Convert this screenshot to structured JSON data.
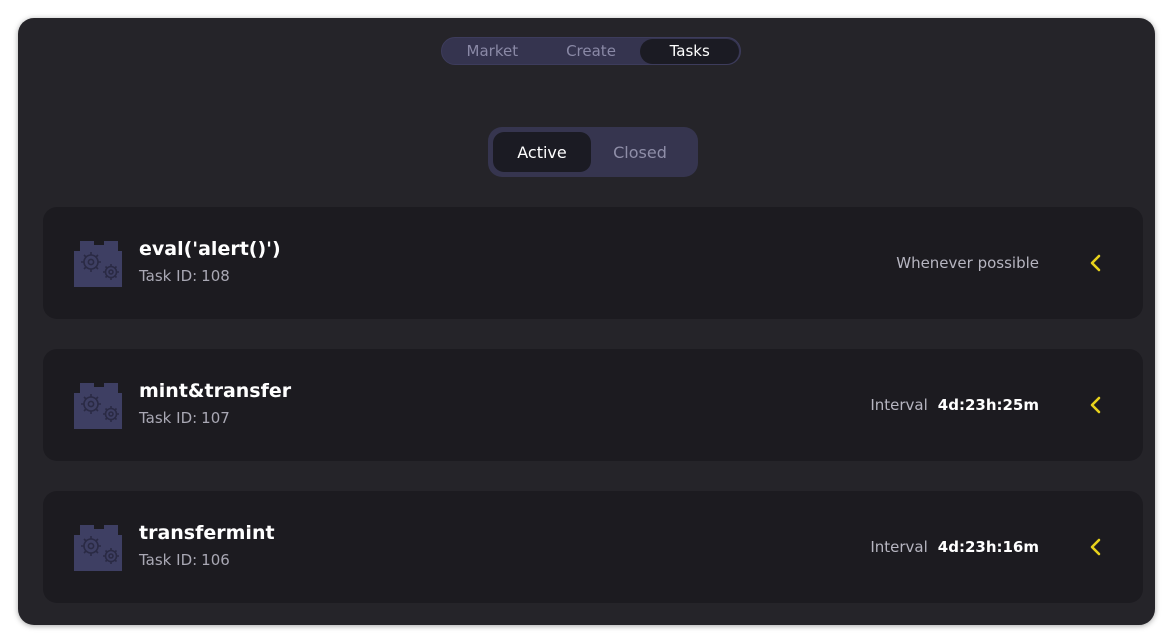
{
  "nav": {
    "tabs": [
      {
        "label": "Market"
      },
      {
        "label": "Create"
      },
      {
        "label": "Tasks"
      }
    ],
    "active": "Tasks"
  },
  "filter": {
    "active_label": "Active",
    "closed_label": "Closed",
    "selected": "Active"
  },
  "tasks": [
    {
      "title": "eval('alert()')",
      "id_label": "Task ID:",
      "id": "108",
      "schedule_label": "Whenever possible",
      "schedule_value": "",
      "icon": "gears-icon"
    },
    {
      "title": "mint&transfer",
      "id_label": "Task ID:",
      "id": "107",
      "schedule_label": "Interval",
      "schedule_value": "4d:23h:25m",
      "icon": "gears-icon"
    },
    {
      "title": "transfermint",
      "id_label": "Task ID:",
      "id": "106",
      "schedule_label": "Interval",
      "schedule_value": "4d:23h:16m",
      "icon": "gears-icon"
    }
  ],
  "colors": {
    "background": "#252429",
    "card": "#1c1b20",
    "accent": "#e7d21c",
    "icon": "#3e3f63"
  }
}
